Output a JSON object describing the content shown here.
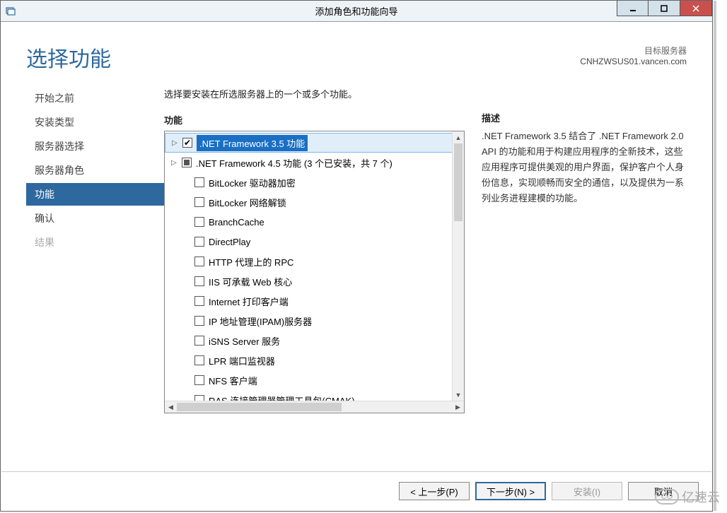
{
  "window": {
    "title": "添加角色和功能向导"
  },
  "header": {
    "page_title": "选择功能",
    "target_label": "目标服务器",
    "target_value": "CNHZWSUS01.vancen.com"
  },
  "nav": {
    "items": [
      {
        "label": "开始之前",
        "state": "normal"
      },
      {
        "label": "安装类型",
        "state": "normal"
      },
      {
        "label": "服务器选择",
        "state": "normal"
      },
      {
        "label": "服务器角色",
        "state": "normal"
      },
      {
        "label": "功能",
        "state": "active"
      },
      {
        "label": "确认",
        "state": "normal"
      },
      {
        "label": "结果",
        "state": "disabled"
      }
    ]
  },
  "main": {
    "intro": "选择要安装在所选服务器上的一个或多个功能。",
    "features_heading": "功能",
    "desc_heading": "描述",
    "features": [
      {
        "label": ".NET Framework 3.5 功能",
        "level": 0,
        "expander": true,
        "check": "checked",
        "selected": true
      },
      {
        "label": ".NET Framework 4.5 功能 (3 个已安装，共 7 个)",
        "level": 0,
        "expander": true,
        "check": "partial"
      },
      {
        "label": "BitLocker 驱动器加密",
        "level": 1,
        "check": "none"
      },
      {
        "label": "BitLocker 网络解锁",
        "level": 1,
        "check": "none"
      },
      {
        "label": "BranchCache",
        "level": 1,
        "check": "none"
      },
      {
        "label": "DirectPlay",
        "level": 1,
        "check": "none"
      },
      {
        "label": "HTTP 代理上的 RPC",
        "level": 1,
        "check": "none"
      },
      {
        "label": "IIS 可承载 Web 核心",
        "level": 1,
        "check": "none"
      },
      {
        "label": "Internet 打印客户端",
        "level": 1,
        "check": "none"
      },
      {
        "label": "IP 地址管理(IPAM)服务器",
        "level": 1,
        "check": "none"
      },
      {
        "label": "iSNS Server 服务",
        "level": 1,
        "check": "none"
      },
      {
        "label": "LPR 端口监视器",
        "level": 1,
        "check": "none"
      },
      {
        "label": "NFS 客户端",
        "level": 1,
        "check": "none"
      },
      {
        "label": "RAS 连接管理器管理工具包(CMAK)",
        "level": 1,
        "check": "none"
      }
    ],
    "description": ".NET Framework 3.5 结合了 .NET Framework 2.0 API 的功能和用于构建应用程序的全新技术，这些应用程序可提供美观的用户界面，保护客户个人身份信息，实现顺畅而安全的通信，以及提供为一系列业务进程建模的功能。"
  },
  "footer": {
    "prev": "< 上一步(P)",
    "next": "下一步(N) >",
    "install": "安装(I)",
    "cancel": "取消"
  },
  "watermark": {
    "cloud": "CO",
    "text": "亿速云"
  }
}
